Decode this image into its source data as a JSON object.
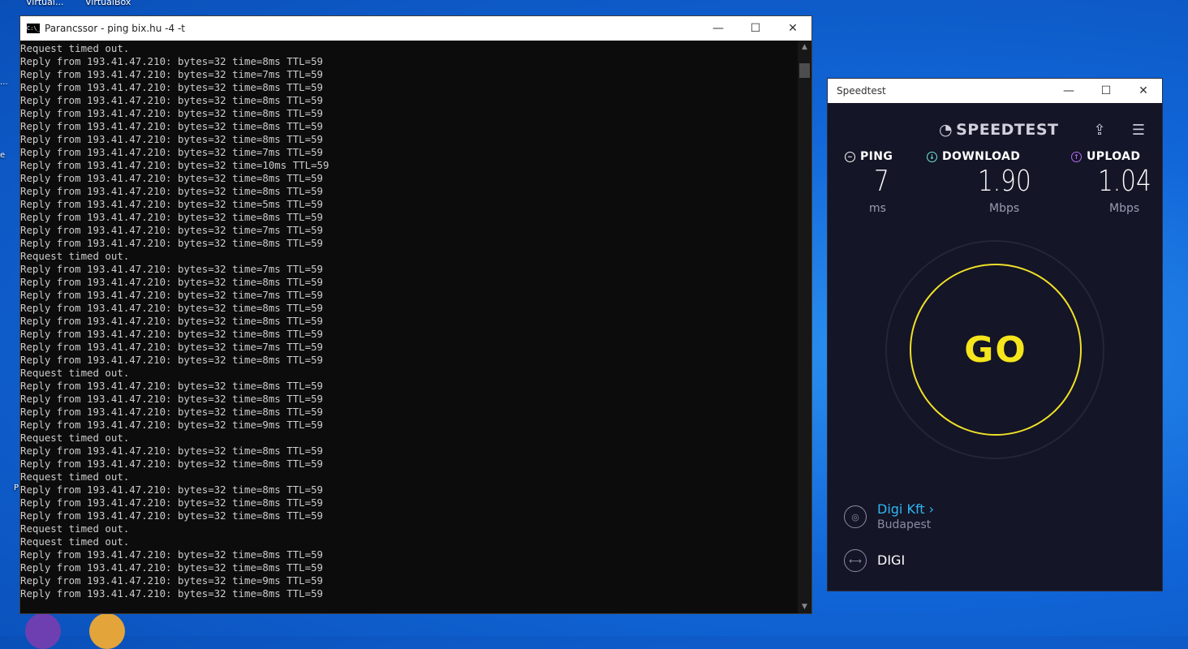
{
  "desktop": {
    "icon_labels": [
      "Virtual...",
      "VirtualBox"
    ],
    "edge_fragments": [
      "...",
      "e",
      "P"
    ]
  },
  "cmd": {
    "title": "Parancssor - ping  bix.hu -4 -t",
    "icon_text": "C:\\_",
    "lines": [
      "Request timed out.",
      "Reply from 193.41.47.210: bytes=32 time=8ms TTL=59",
      "Reply from 193.41.47.210: bytes=32 time=7ms TTL=59",
      "Reply from 193.41.47.210: bytes=32 time=8ms TTL=59",
      "Reply from 193.41.47.210: bytes=32 time=8ms TTL=59",
      "Reply from 193.41.47.210: bytes=32 time=8ms TTL=59",
      "Reply from 193.41.47.210: bytes=32 time=8ms TTL=59",
      "Reply from 193.41.47.210: bytes=32 time=8ms TTL=59",
      "Reply from 193.41.47.210: bytes=32 time=7ms TTL=59",
      "Reply from 193.41.47.210: bytes=32 time=10ms TTL=59",
      "Reply from 193.41.47.210: bytes=32 time=8ms TTL=59",
      "Reply from 193.41.47.210: bytes=32 time=8ms TTL=59",
      "Reply from 193.41.47.210: bytes=32 time=5ms TTL=59",
      "Reply from 193.41.47.210: bytes=32 time=8ms TTL=59",
      "Reply from 193.41.47.210: bytes=32 time=7ms TTL=59",
      "Reply from 193.41.47.210: bytes=32 time=8ms TTL=59",
      "Request timed out.",
      "Reply from 193.41.47.210: bytes=32 time=7ms TTL=59",
      "Reply from 193.41.47.210: bytes=32 time=8ms TTL=59",
      "Reply from 193.41.47.210: bytes=32 time=7ms TTL=59",
      "Reply from 193.41.47.210: bytes=32 time=8ms TTL=59",
      "Reply from 193.41.47.210: bytes=32 time=8ms TTL=59",
      "Reply from 193.41.47.210: bytes=32 time=8ms TTL=59",
      "Reply from 193.41.47.210: bytes=32 time=7ms TTL=59",
      "Reply from 193.41.47.210: bytes=32 time=8ms TTL=59",
      "Request timed out.",
      "Reply from 193.41.47.210: bytes=32 time=8ms TTL=59",
      "Reply from 193.41.47.210: bytes=32 time=8ms TTL=59",
      "Reply from 193.41.47.210: bytes=32 time=8ms TTL=59",
      "Reply from 193.41.47.210: bytes=32 time=9ms TTL=59",
      "Request timed out.",
      "Reply from 193.41.47.210: bytes=32 time=8ms TTL=59",
      "Reply from 193.41.47.210: bytes=32 time=8ms TTL=59",
      "Request timed out.",
      "Reply from 193.41.47.210: bytes=32 time=8ms TTL=59",
      "Reply from 193.41.47.210: bytes=32 time=8ms TTL=59",
      "Reply from 193.41.47.210: bytes=32 time=8ms TTL=59",
      "Request timed out.",
      "Request timed out.",
      "Reply from 193.41.47.210: bytes=32 time=8ms TTL=59",
      "Reply from 193.41.47.210: bytes=32 time=8ms TTL=59",
      "Reply from 193.41.47.210: bytes=32 time=9ms TTL=59",
      "Reply from 193.41.47.210: bytes=32 time=8ms TTL=59"
    ]
  },
  "speedtest": {
    "title": "Speedtest",
    "logo": "SPEEDTEST",
    "ping": {
      "label": "PING",
      "value": "7",
      "unit": "ms",
      "color": "#ffffff"
    },
    "download": {
      "label": "DOWNLOAD",
      "value": "1.90",
      "unit": "Mbps",
      "color": "#6ee7d8"
    },
    "upload": {
      "label": "UPLOAD",
      "value": "1.04",
      "unit": "Mbps",
      "color": "#b66bf5"
    },
    "go_label": "GO",
    "provider": {
      "name": "Digi Kft",
      "location": "Budapest"
    },
    "isp": "DIGI",
    "accent": "#f5e51c",
    "link_color": "#2fb6f5"
  },
  "window_controls": {
    "minimize": "—",
    "maximize": "☐",
    "close": "✕"
  }
}
